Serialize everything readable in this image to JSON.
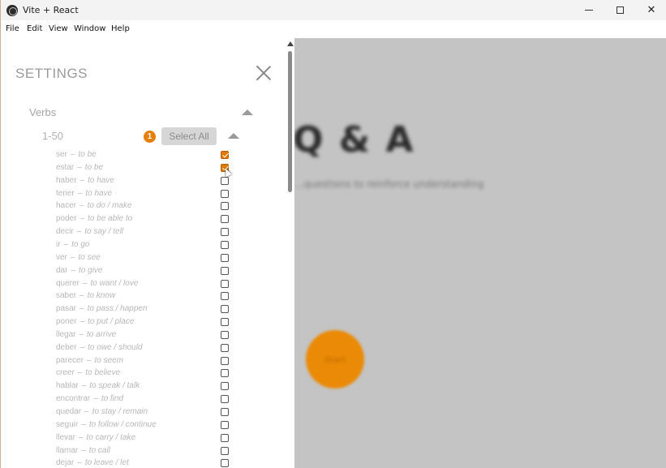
{
  "window": {
    "title": "Vite + React",
    "controls": {
      "minimize_icon": "minimize-icon",
      "maximize_icon": "maximize-icon",
      "close_icon": "close-icon"
    }
  },
  "menu": [
    "File",
    "Edit",
    "View",
    "Window",
    "Help"
  ],
  "background": {
    "heading": "Q & A",
    "subtitle": "...questions to reinforce understanding",
    "start_button": "Start"
  },
  "settings": {
    "title": "SETTINGS",
    "close_icon": "close-icon",
    "section": {
      "label": "Verbs",
      "group": {
        "label": "1-50",
        "selected_count": "1",
        "select_all_label": "Select All",
        "items": [
          {
            "verb": "ser",
            "meaning": "to be",
            "checked": true
          },
          {
            "verb": "estar",
            "meaning": "to be",
            "checked": true
          },
          {
            "verb": "haber",
            "meaning": "to have",
            "checked": false
          },
          {
            "verb": "tener",
            "meaning": "to have",
            "checked": false
          },
          {
            "verb": "hacer",
            "meaning": "to do / make",
            "checked": false
          },
          {
            "verb": "poder",
            "meaning": "to be able to",
            "checked": false
          },
          {
            "verb": "decir",
            "meaning": "to say / tell",
            "checked": false
          },
          {
            "verb": "ir",
            "meaning": "to go",
            "checked": false
          },
          {
            "verb": "ver",
            "meaning": "to see",
            "checked": false
          },
          {
            "verb": "dar",
            "meaning": "to give",
            "checked": false
          },
          {
            "verb": "querer",
            "meaning": "to want / love",
            "checked": false
          },
          {
            "verb": "saber",
            "meaning": "to know",
            "checked": false
          },
          {
            "verb": "pasar",
            "meaning": "to pass / happen",
            "checked": false
          },
          {
            "verb": "poner",
            "meaning": "to put / place",
            "checked": false
          },
          {
            "verb": "llegar",
            "meaning": "to arrive",
            "checked": false
          },
          {
            "verb": "deber",
            "meaning": "to owe / should",
            "checked": false
          },
          {
            "verb": "parecer",
            "meaning": "to seem",
            "checked": false
          },
          {
            "verb": "creer",
            "meaning": "to believe",
            "checked": false
          },
          {
            "verb": "hablar",
            "meaning": "to speak / talk",
            "checked": false
          },
          {
            "verb": "encontrar",
            "meaning": "to find",
            "checked": false
          },
          {
            "verb": "quedar",
            "meaning": "to stay / remain",
            "checked": false
          },
          {
            "verb": "seguir",
            "meaning": "to follow / continue",
            "checked": false
          },
          {
            "verb": "llevar",
            "meaning": "to carry / take",
            "checked": false
          },
          {
            "verb": "llamar",
            "meaning": "to call",
            "checked": false
          },
          {
            "verb": "dejar",
            "meaning": "to leave / let",
            "checked": false
          }
        ]
      }
    }
  },
  "colors": {
    "accent": "#e48008",
    "overlay": "#c4c4c4"
  }
}
